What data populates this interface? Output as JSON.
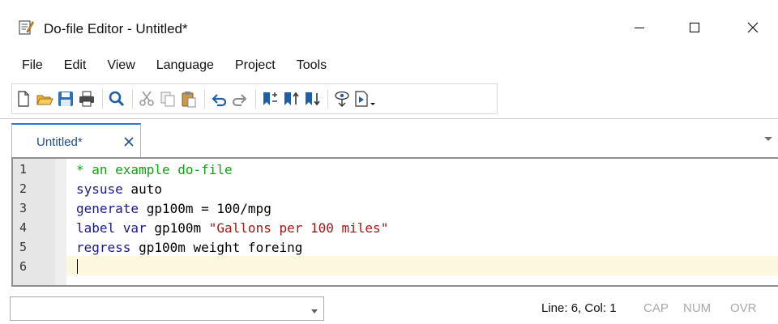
{
  "window": {
    "title": "Do-file Editor - Untitled*",
    "controls": [
      "minimize",
      "maximize",
      "close"
    ]
  },
  "menu": [
    "File",
    "Edit",
    "View",
    "Language",
    "Project",
    "Tools"
  ],
  "toolbar": {
    "groups": [
      [
        "new-file-icon",
        "open-folder-icon",
        "save-icon",
        "print-icon"
      ],
      [
        "find-icon"
      ],
      [
        "cut-icon",
        "copy-icon",
        "paste-icon"
      ],
      [
        "undo-icon",
        "redo-icon"
      ],
      [
        "toggle-bookmark-icon",
        "previous-bookmark-icon",
        "next-bookmark-icon"
      ],
      [
        "show-file-in-viewer-icon",
        "execute-dropdown-icon"
      ]
    ]
  },
  "tabs": [
    {
      "label": "Untitled*",
      "active": true
    }
  ],
  "editor": {
    "lines": [
      {
        "num": "1",
        "tokens": [
          {
            "type": "comment",
            "text": "* an example do-file"
          }
        ]
      },
      {
        "num": "2",
        "tokens": [
          {
            "type": "keyword",
            "text": "sysuse"
          },
          {
            "type": "plain",
            "text": " auto"
          }
        ]
      },
      {
        "num": "3",
        "tokens": [
          {
            "type": "keyword",
            "text": "generate"
          },
          {
            "type": "plain",
            "text": " gp100m = 100/mpg"
          }
        ]
      },
      {
        "num": "4",
        "tokens": [
          {
            "type": "keyword",
            "text": "label var"
          },
          {
            "type": "plain",
            "text": " gp100m "
          },
          {
            "type": "string",
            "text": "\"Gallons per 100 miles\""
          }
        ]
      },
      {
        "num": "5",
        "tokens": [
          {
            "type": "keyword",
            "text": "regress"
          },
          {
            "type": "plain",
            "text": " gp100m weight foreing"
          }
        ]
      },
      {
        "num": "6",
        "tokens": []
      }
    ],
    "current_line": 6
  },
  "status": {
    "command_value": "",
    "position": "Line: 6, Col: 1",
    "flags": [
      "CAP",
      "NUM",
      "OVR"
    ]
  },
  "colors": {
    "comment": "#12a012",
    "keyword": "#1a1a8c",
    "string": "#a31515",
    "accent": "#2b78c6",
    "current_line_bg": "#fbf8dd"
  }
}
